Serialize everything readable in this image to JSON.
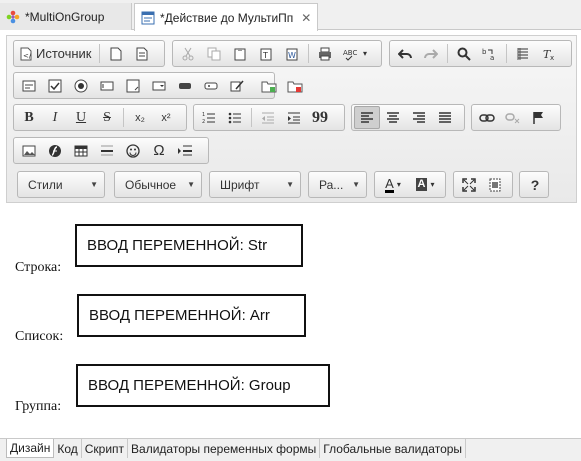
{
  "editor_tabs": [
    {
      "label": "*MultiOnGroup",
      "icon": "flower-icon"
    },
    {
      "label": "*Действие до МультиПп",
      "icon": "form-icon",
      "close": "✕"
    }
  ],
  "toolbar": {
    "source_label": "Источник",
    "styles_label": "Стили",
    "format_label": "Обычное",
    "font_label": "Шрифт",
    "size_label": "Ра...",
    "bold": "B",
    "italic": "I",
    "underline": "U",
    "strike": "S",
    "subscript": "x₂",
    "superscript": "x²",
    "quote": "99",
    "omega": "Ω",
    "help": "?",
    "text_color": "A",
    "bg_color": "A"
  },
  "fields": [
    {
      "label": "Строка:",
      "value": "ВВОД ПЕРЕМЕННОЙ: Str"
    },
    {
      "label": "Список:",
      "value": "ВВОД ПЕРЕМЕННОЙ: Arr"
    },
    {
      "label": "Группа:",
      "value": "ВВОД ПЕРЕМЕННОЙ: Group"
    }
  ],
  "bottom_tabs": [
    "Дизайн",
    "Код",
    "Скрипт",
    "Валидаторы переменных формы",
    "Глобальные валидаторы"
  ],
  "colors": {
    "accent_active": "#cfcfcf",
    "box_border": "#111111"
  }
}
